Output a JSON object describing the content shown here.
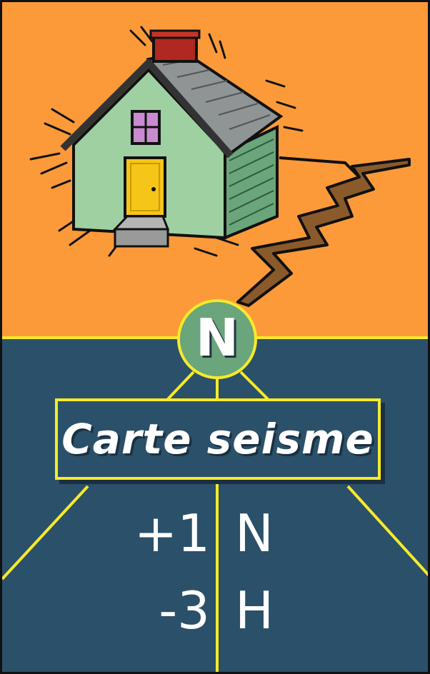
{
  "card": {
    "badge_letter": "N",
    "title": "Carte seisme",
    "effects": [
      {
        "amount": "+1",
        "resource": "N"
      },
      {
        "amount": "-3",
        "resource": "H"
      }
    ],
    "illustration": "earthquake-house-with-ground-crack",
    "colors": {
      "top_background": "#fc9a39",
      "bottom_background": "#2b5069",
      "accent_yellow": "#f7ea2c",
      "badge_green": "#6aa57b"
    }
  }
}
